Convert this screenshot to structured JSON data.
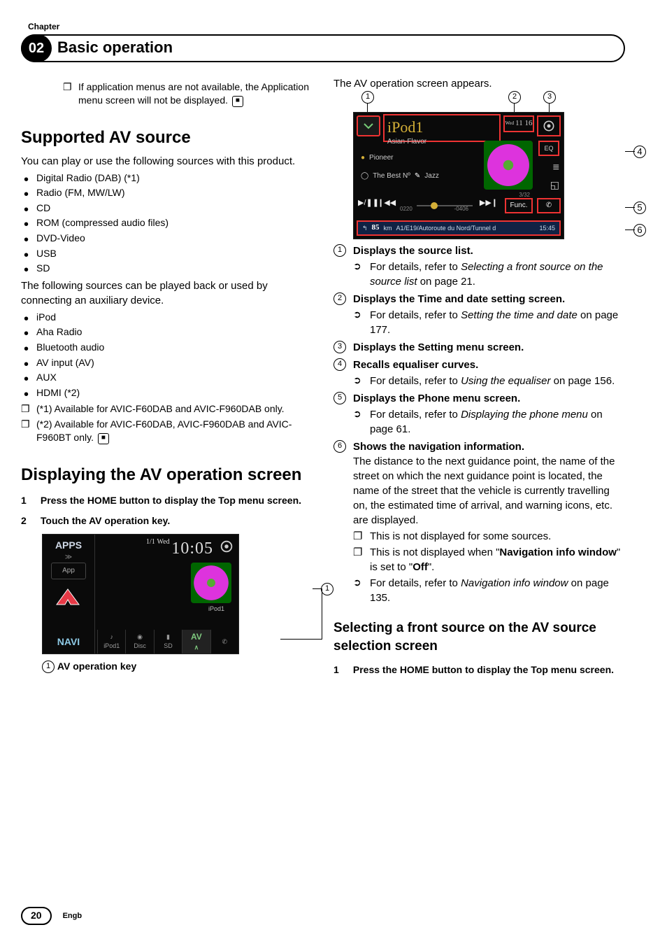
{
  "chapter": {
    "label": "Chapter",
    "number": "02",
    "title": "Basic operation"
  },
  "col1": {
    "intro_note": "If application menus are not available, the Application menu screen will not be displayed.",
    "supported_heading": "Supported AV source",
    "supported_intro": "You can play or use the following sources with this product.",
    "sources1": [
      "Digital Radio (DAB) (*1)",
      "Radio (FM, MW/LW)",
      "CD",
      "ROM (compressed audio files)",
      "DVD-Video",
      "USB",
      "SD"
    ],
    "aux_intro": "The following sources can be played back or used by connecting an auxiliary device.",
    "sources2": [
      "iPod",
      "Aha Radio",
      "Bluetooth audio",
      "AV input (AV)",
      "AUX",
      "HDMI (*2)"
    ],
    "footnotes": [
      "(*1) Available for AVIC-F60DAB and AVIC-F960DAB only.",
      "(*2) Available for AVIC-F60DAB, AVIC-F960DAB and AVIC-F960BT only."
    ],
    "displaying_heading": "Displaying the AV operation screen",
    "step1_num": "1",
    "step1": "Press the HOME button to display the Top menu screen.",
    "step2_num": "2",
    "step2": "Touch the AV operation key.",
    "shot1": {
      "apps": "APPS",
      "apps_sub": "≫",
      "app_box": "App",
      "navi": "NAVI",
      "navi_sub": "≫",
      "date_small": "1/1",
      "weekday": "Wed",
      "time": "10:05",
      "ipod": "iPod1",
      "tabs": {
        "ipod": "iPod1",
        "disc": "Disc",
        "sd": "SD",
        "av": "AV",
        "phone": ""
      }
    },
    "shot1_callout": "1",
    "legend1": {
      "num": "1",
      "label_prefix": "AV",
      "label_rest": " operation key"
    }
  },
  "col2": {
    "appears": "The AV operation screen appears.",
    "shot2": {
      "title": "iPod1",
      "subtitle": "Asian-Flavor",
      "datetime": "11 16",
      "weekday": "Wed",
      "artist": "Pioneer",
      "album": "The Best Nº",
      "genre": "Jazz",
      "eq": "EQ",
      "track": "3/32",
      "time_l": "0220",
      "time_r": "-0406",
      "func": "Func.",
      "nav_km": "85",
      "nav_unit": "km",
      "nav_text": "A1/E19/Autoroute du Nord/Tunnel d",
      "nav_eta": "15:45"
    },
    "callouts": {
      "c1": "1",
      "c2": "2",
      "c3": "3",
      "c4": "4",
      "c5": "5",
      "c6": "6"
    },
    "legend": [
      {
        "num": "1",
        "title": "Displays the source list.",
        "sub": [
          {
            "type": "arrow",
            "pre": "For details, refer to ",
            "it": "Selecting a front source on the source list",
            "post": " on page 21."
          }
        ]
      },
      {
        "num": "2",
        "title": "Displays the Time and date setting screen.",
        "sub": [
          {
            "type": "arrow",
            "pre": "For details, refer to ",
            "it": "Setting the time and date",
            "post": " on page 177."
          }
        ]
      },
      {
        "num": "3",
        "title": "Displays the Setting menu screen."
      },
      {
        "num": "4",
        "title": "Recalls equaliser curves.",
        "sub": [
          {
            "type": "arrow",
            "pre": "For details, refer to ",
            "it": "Using the equaliser",
            "post": " on page 156."
          }
        ]
      },
      {
        "num": "5",
        "title": "Displays the Phone menu screen.",
        "sub": [
          {
            "type": "arrow",
            "pre": "For details, refer to ",
            "it": "Displaying the phone menu",
            "post": " on page 61."
          }
        ]
      },
      {
        "num": "6",
        "title": "Shows the navigation information.",
        "body": "The distance to the next guidance point, the name of the street on which the next guidance point is located, the name of the street that the vehicle is currently travelling on, the estimated time of arrival, and warning icons, etc. are displayed.",
        "sub": [
          {
            "type": "box",
            "text": "This is not displayed for some sources."
          },
          {
            "type": "box",
            "pre": "This is not displayed when \"",
            "b1": "Navigation info window",
            "mid": "\" is set to \"",
            "b2": "Off",
            "post": "\"."
          },
          {
            "type": "arrow",
            "pre": "For details, refer to ",
            "it": "Navigation info window",
            "post": " on page 135."
          }
        ]
      }
    ],
    "selecting_heading": "Selecting a front source on the AV source selection screen",
    "sel_step1_num": "1",
    "sel_step1": "Press the HOME button to display the Top menu screen."
  },
  "footer": {
    "page": "20",
    "lang": "Engb"
  }
}
